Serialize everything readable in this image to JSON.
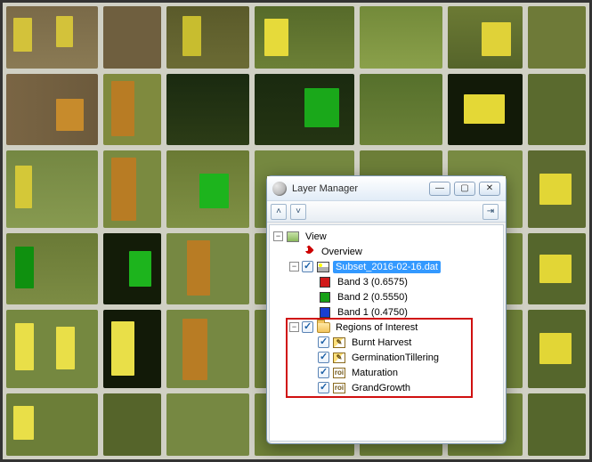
{
  "window": {
    "title": "Layer Manager",
    "minimize_glyph": "—",
    "maximize_glyph": "▢",
    "close_glyph": "✕"
  },
  "toolbar": {
    "up_glyph": "˄",
    "down_glyph": "˅",
    "pin_glyph": "⇥"
  },
  "tree": {
    "view": {
      "label": "View",
      "overview": {
        "label": "Overview"
      },
      "dataset": {
        "label": "Subset_2016-02-16.dat",
        "bands": [
          {
            "label": "Band 3 (0.6575)",
            "color": "#d11a1a"
          },
          {
            "label": "Band 2 (0.5550)",
            "color": "#16a016"
          },
          {
            "label": "Band 1 (0.4750)",
            "color": "#1a3fd1"
          }
        ]
      },
      "roi": {
        "label": "Regions of Interest",
        "items": [
          {
            "label": "Burnt Harvest",
            "icon": "poly"
          },
          {
            "label": "GerminationTillering",
            "icon": "poly"
          },
          {
            "label": "Maturation",
            "icon": "roi"
          },
          {
            "label": "GrandGrowth",
            "icon": "roi"
          }
        ]
      }
    }
  }
}
